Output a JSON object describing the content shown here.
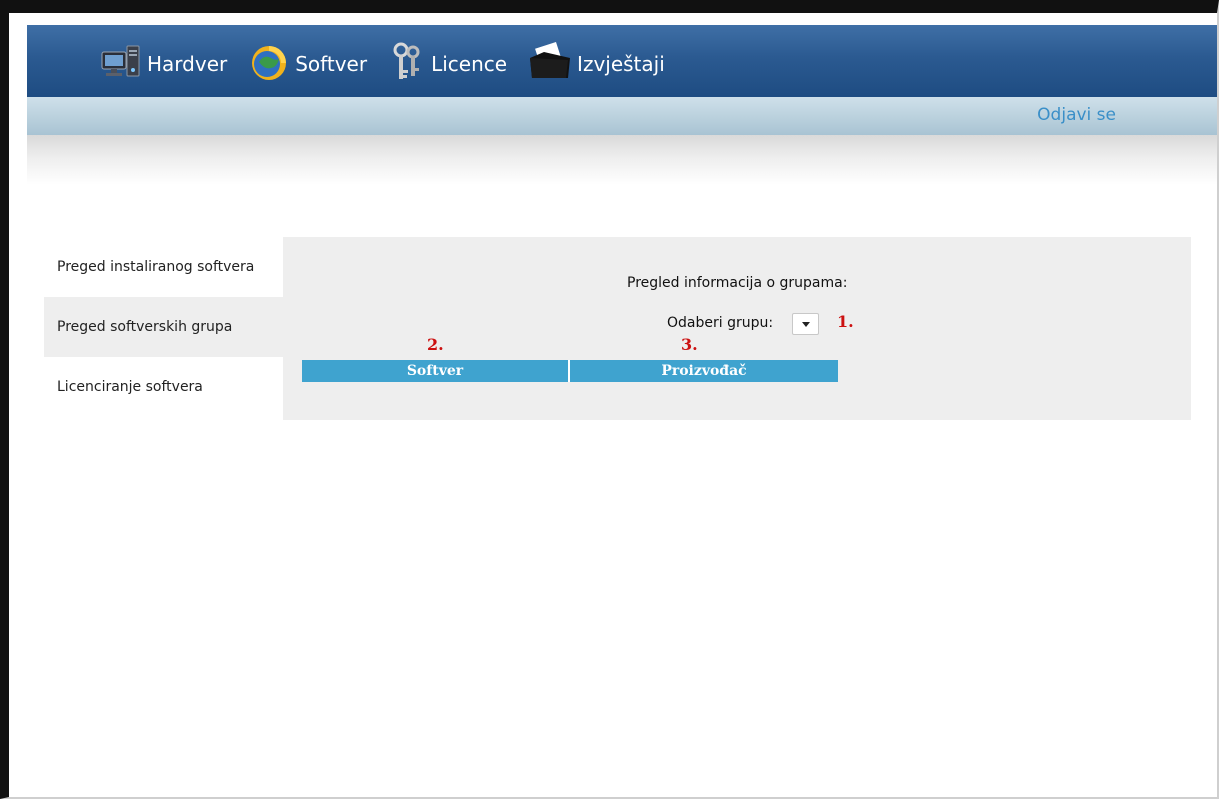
{
  "nav": {
    "items": [
      {
        "label": "Hardver",
        "icon": "computer-icon"
      },
      {
        "label": "Softver",
        "icon": "software-globe-icon"
      },
      {
        "label": "Licence",
        "icon": "keys-icon"
      },
      {
        "label": "Izvještaji",
        "icon": "folder-icon"
      }
    ],
    "logout_label": "Odjavi se"
  },
  "sidebar": {
    "items": [
      {
        "label": "Preged instaliranog softvera",
        "active": false
      },
      {
        "label": "Preged softverskih grupa",
        "active": true
      },
      {
        "label": "Licenciranje softvera",
        "active": false
      }
    ]
  },
  "main": {
    "title": "Pregled informacija o grupama:",
    "group_label": "Odaberi grupu:",
    "group_select_value": "",
    "markers": [
      "1.",
      "2.",
      "3."
    ],
    "table": {
      "columns": [
        "Softver",
        "Proizvođač"
      ],
      "rows": []
    }
  },
  "colors": {
    "header": "#2b5a91",
    "subbar": "#b8cfdc",
    "logout": "#3a8fc8",
    "table_header": "#3fa3cf",
    "marker": "#cc1111",
    "panel": "#eeeeee"
  }
}
